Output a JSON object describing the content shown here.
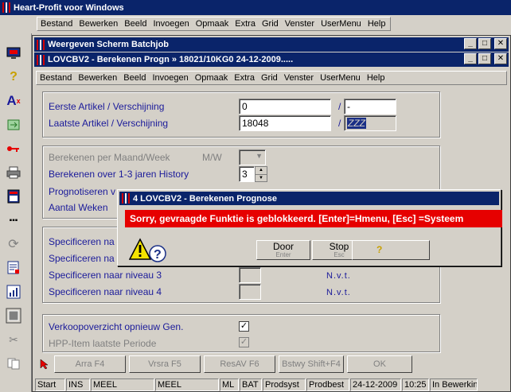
{
  "app": {
    "title": "Heart-Profit voor Windows",
    "menu": [
      "Bestand",
      "Bewerken",
      "Beeld",
      "Invoegen",
      "Opmaak",
      "Extra",
      "Grid",
      "Venster",
      "UserMenu",
      "Help"
    ]
  },
  "toolbar": {
    "icons": [
      "monitor-icon",
      "help-icon",
      "font-icon",
      "transfer-icon",
      "key-icon",
      "printer-icon",
      "calculator-icon",
      "dots-icon",
      "refresh-icon",
      "form-icon",
      "chart-icon",
      "window-icon",
      "scissors-icon",
      "copy-icon"
    ]
  },
  "outer_window": {
    "title": "Weergeven Scherm Batchjob"
  },
  "inner_window": {
    "title": "LOVCBV2 - Berekenen Progn  »  18021/10KG0   24-12-2009.....",
    "menu": [
      "Bestand",
      "Bewerken",
      "Beeld",
      "Invoegen",
      "Opmaak",
      "Extra",
      "Grid",
      "Venster",
      "UserMenu",
      "Help"
    ]
  },
  "form": {
    "eerste_label": "Eerste Artikel / Verschijning",
    "eerste_value": "0",
    "eerste_sep": "/",
    "eerste_value2": "-",
    "laatste_label": "Laatste Artikel / Verschijning",
    "laatste_value": "18048",
    "laatste_sep": "/",
    "laatste_value2": "ZZZ",
    "per_maand_label": "Berekenen per Maand/Week",
    "per_maand_mw": "M/W",
    "over_jaren_label": "Berekenen over 1-3 jaren History",
    "over_jaren_value": "3",
    "prognose_label": "Prognotiseren v",
    "aantal_label": "Aantal Weken",
    "spec1_label": "Specificeren na",
    "spec2_label": "Specificeren na",
    "spec3_label": "Specificeren naar niveau 3",
    "spec3_value": "N.v.t.",
    "spec4_label": "Specificeren naar niveau 4",
    "spec4_value": "N.v.t.",
    "verkoop_label": "Verkoopoverzicht opnieuw Gen.",
    "verkoop_checked": "✓",
    "hpp_label": "HPP-Item laatste Periode",
    "hpp_checked": "✓"
  },
  "buttons": {
    "arra": "Arra   F4",
    "vrsra": "Vrsra   F5",
    "resav": "ResAV   F6",
    "bstwy": "Bstwy  Shift+F4",
    "ok": "OK"
  },
  "status": {
    "cells": [
      "Start",
      "INS",
      "MEEL",
      "MEEL",
      "ML",
      "BAT",
      "Prodsyst",
      "Prodbest",
      "24-12-2009",
      "10:25",
      "In Bewerking"
    ]
  },
  "dialog": {
    "title": "4 LOVCBV2 - Berekenen Prognose",
    "message": "Sorry, gevraagde Funktie is geblokkeerd.  [Enter]=Hmenu, [Esc] =Systeem",
    "door_label": "Door",
    "door_key": "Enter",
    "stop_label": "Stop",
    "stop_key": "Esc",
    "help_glyph": "?"
  }
}
